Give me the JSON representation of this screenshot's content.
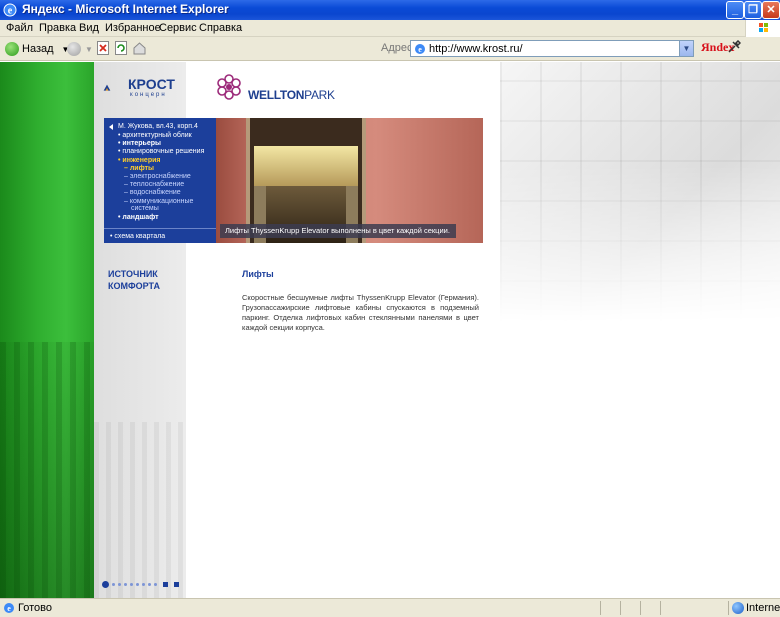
{
  "window": {
    "title": "Яндекс - Microsoft Internet Explorer"
  },
  "menu": {
    "items": [
      "Файл",
      "Правка",
      "Вид",
      "Избранное",
      "Сервис",
      "Справка"
    ]
  },
  "toolbar": {
    "back_label": "Назад",
    "address_label": "Адрес:",
    "url": "http://www.krost.ru/",
    "yandex_label": "Яndex"
  },
  "site": {
    "brand": "КРОСТ",
    "brand_sub": "концерн",
    "partner_brand_a": "WELLTON",
    "partner_brand_b": "PARK",
    "nav": {
      "address": "М. Жукова, вл.43, корп.4",
      "items": [
        {
          "label": "архитектурный облик",
          "state": "normal"
        },
        {
          "label": "интерьеры",
          "state": "bold"
        },
        {
          "label": "планировочные решения",
          "state": "normal"
        },
        {
          "label": "инженерия",
          "state": "active"
        }
      ],
      "subitems": [
        {
          "label": "– лифты",
          "state": "active"
        },
        {
          "label": "– электроснабжение",
          "state": "normal"
        },
        {
          "label": "– теплоснабжение",
          "state": "normal"
        },
        {
          "label": "– водоснабжение",
          "state": "normal"
        },
        {
          "label": "– коммуникационные",
          "state": "normal"
        },
        {
          "label": "системы",
          "state": "normal"
        }
      ],
      "landscape": "ландшафт",
      "scheme": "схема квартала"
    },
    "hero_caption": "Лифты ThyssenKrupp Elevator выполнены в цвет каждой секции.",
    "slogan_line1": "ИСТОЧНИК",
    "slogan_line2": "КОМФОРТА",
    "article": {
      "title": "Лифты",
      "body": "Скоростные бесшумные лифты ThyssenKrupp Elevator (Германия). Грузопассажирские лифтовые кабины спускаются в подземный паркинг. Отделка лифтовых кабин стеклянными панелями в цвет каждой секции корпуса."
    }
  },
  "status": {
    "text": "Готово",
    "zone": "Internet"
  },
  "colors": {
    "xp_blue": "#0a4ad6",
    "site_blue": "#1c3f9b",
    "site_green": "#2fae2f",
    "nav_active": "#ffcf2b"
  }
}
